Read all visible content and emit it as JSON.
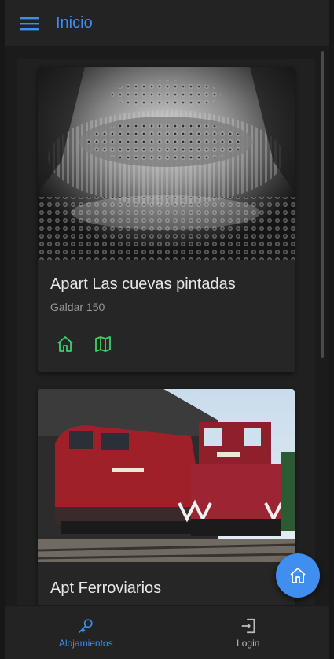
{
  "app": {
    "title": "Inicio"
  },
  "colors": {
    "accent": "#3d8ef0",
    "action_icon": "#39d36b",
    "fab": "#3f8ef0"
  },
  "listings": [
    {
      "title": "Apart Las cuevas pintadas",
      "subtitle": "Galdar 150",
      "image": "fractal-cave-image",
      "actions": [
        "home-icon",
        "map-icon"
      ]
    },
    {
      "title": "Apt Ferroviarios",
      "subtitle": "",
      "image": "red-locomotives-image"
    }
  ],
  "fab": {
    "icon": "home-icon"
  },
  "bottom_nav": [
    {
      "label": "Alojamientos",
      "icon": "key-icon",
      "active": true
    },
    {
      "label": "Login",
      "icon": "login-icon",
      "active": false
    }
  ]
}
